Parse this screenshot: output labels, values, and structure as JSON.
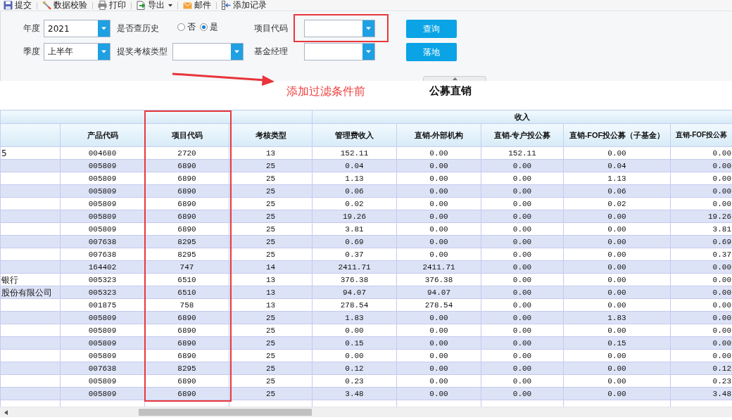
{
  "toolbar": {
    "items": [
      {
        "kind": "save",
        "label": "提交",
        "dropdown": false
      },
      {
        "kind": "check",
        "label": "数据校验",
        "dropdown": false
      },
      {
        "kind": "print",
        "label": "打印",
        "dropdown": false
      },
      {
        "kind": "export",
        "label": "导出",
        "dropdown": true
      },
      {
        "kind": "mail",
        "label": "邮件",
        "dropdown": false
      },
      {
        "kind": "add",
        "label": "添加记录",
        "dropdown": false
      }
    ]
  },
  "filter_rows": [
    {
      "fields": [
        {
          "kind": "combo",
          "label": "年度",
          "value": "2021",
          "highlighted": false
        },
        {
          "kind": "radio",
          "label": "是否查历史",
          "options": [
            {
              "label": "否",
              "selected": false
            },
            {
              "label": "是",
              "selected": true
            }
          ]
        },
        {
          "kind": "combo",
          "label": "项目代码",
          "highlighted": true
        }
      ],
      "button": "查询"
    },
    {
      "fields": [
        {
          "kind": "combo",
          "label": "季度",
          "value": "上半年",
          "highlighted": false
        },
        {
          "kind": "combo",
          "label": "提奖考核类型",
          "highlighted": false
        },
        {
          "kind": "combo",
          "label": "基金经理",
          "highlighted": false
        }
      ],
      "button": "落地"
    }
  ],
  "annotation": {
    "note": "添加过滤条件前"
  },
  "title": "公募直销",
  "table": {
    "column_groups": [
      {
        "columns": [
          {
            "highlighted": false
          },
          {
            "label": "产品代码",
            "highlighted": false
          },
          {
            "label": "项目代码",
            "highlighted": true
          },
          {
            "label": "考核类型",
            "highlighted": false
          }
        ]
      },
      {
        "label": "收入",
        "columns": [
          {
            "label": "管理费收入",
            "highlighted": false
          },
          {
            "label": "直销-外部机构",
            "highlighted": false
          },
          {
            "label": "直销-专户投公募",
            "highlighted": false
          },
          {
            "label": "直销-FOF投公募（子基金）",
            "highlighted": false
          },
          {
            "label": "直销-FOF投公募",
            "highlighted": false
          }
        ]
      }
    ],
    "rows": [
      {
        "column_1": "5",
        "values": [
          "004680",
          "2720",
          "13",
          "152.11",
          "0.00",
          "152.11",
          "0.00",
          "0.00"
        ]
      },
      {
        "values": [
          "005809",
          "6890",
          "25",
          "0.04",
          "0.00",
          "0.00",
          "0.04",
          "0.00"
        ]
      },
      {
        "values": [
          "005809",
          "6890",
          "25",
          "1.13",
          "0.00",
          "0.00",
          "1.13",
          "0.00"
        ]
      },
      {
        "values": [
          "005809",
          "6890",
          "25",
          "0.06",
          "0.00",
          "0.00",
          "0.06",
          "0.00"
        ]
      },
      {
        "values": [
          "005809",
          "6890",
          "25",
          "0.02",
          "0.00",
          "0.00",
          "0.02",
          "0.00"
        ]
      },
      {
        "values": [
          "005809",
          "6890",
          "25",
          "19.26",
          "0.00",
          "0.00",
          "0.00",
          "19.26"
        ]
      },
      {
        "values": [
          "005809",
          "6890",
          "25",
          "3.81",
          "0.00",
          "0.00",
          "0.00",
          "3.81"
        ]
      },
      {
        "values": [
          "007638",
          "8295",
          "25",
          "0.69",
          "0.00",
          "0.00",
          "0.00",
          "0.69"
        ]
      },
      {
        "values": [
          "007638",
          "8295",
          "25",
          "0.37",
          "0.00",
          "0.00",
          "0.00",
          "0.37"
        ]
      },
      {
        "values": [
          "164402",
          "747",
          "14",
          "2411.71",
          "2411.71",
          "0.00",
          "0.00",
          "0.00"
        ]
      },
      {
        "column_1": "银行",
        "values": [
          "005323",
          "6510",
          "13",
          "376.38",
          "376.38",
          "0.00",
          "0.00",
          "0.00"
        ]
      },
      {
        "column_1": "股份有限公司",
        "values": [
          "005323",
          "6510",
          "13",
          "94.07",
          "94.07",
          "0.00",
          "0.00",
          "0.00"
        ]
      },
      {
        "values": [
          "001875",
          "758",
          "13",
          "278.54",
          "278.54",
          "0.00",
          "0.00",
          "0.00"
        ]
      },
      {
        "values": [
          "005809",
          "6890",
          "25",
          "1.83",
          "0.00",
          "0.00",
          "1.83",
          "0.00"
        ]
      },
      {
        "values": [
          "005809",
          "6890",
          "25",
          "0.00",
          "0.00",
          "0.00",
          "0.00",
          "0.00"
        ]
      },
      {
        "values": [
          "005809",
          "6890",
          "25",
          "0.15",
          "0.00",
          "0.00",
          "0.15",
          "0.00"
        ]
      },
      {
        "values": [
          "005809",
          "6890",
          "25",
          "0.00",
          "0.00",
          "0.00",
          "0.00",
          "0.00"
        ]
      },
      {
        "values": [
          "007638",
          "8295",
          "25",
          "0.12",
          "0.00",
          "0.00",
          "0.00",
          "0.12"
        ]
      },
      {
        "values": [
          "005809",
          "6890",
          "25",
          "0.23",
          "0.00",
          "0.00",
          "0.00",
          "0.23"
        ]
      },
      {
        "values": [
          "005809",
          "6890",
          "25",
          "3.48",
          "0.00",
          "0.00",
          "0.00",
          "3.48"
        ]
      }
    ]
  }
}
